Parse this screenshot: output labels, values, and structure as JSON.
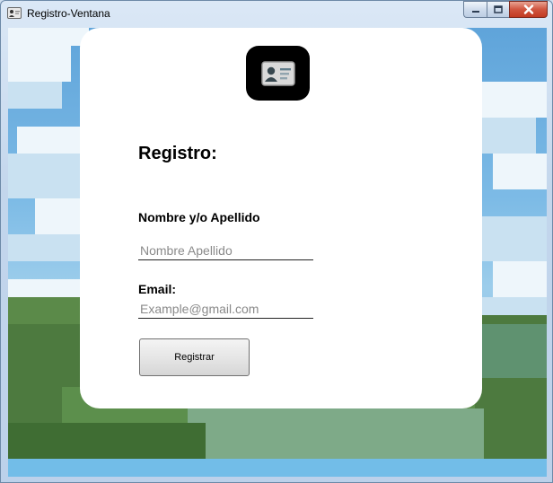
{
  "window": {
    "title": "Registro-Ventana",
    "icon": "id-card-icon"
  },
  "caption_buttons": {
    "minimize_icon": "minimize-icon",
    "maximize_icon": "maximize-icon",
    "close_icon": "close-icon"
  },
  "form": {
    "logo_icon": "id-card-icon",
    "heading": "Registro:",
    "name": {
      "label": "Nombre y/o Apellido",
      "placeholder": "Nombre Apellido",
      "value": ""
    },
    "email": {
      "label": "Email:",
      "placeholder": "Example@gmail.com",
      "value": ""
    },
    "submit_label": "Registrar"
  },
  "colors": {
    "card_background": "#ffffff",
    "logo_background": "#000000",
    "close_button": "#c8452d"
  }
}
